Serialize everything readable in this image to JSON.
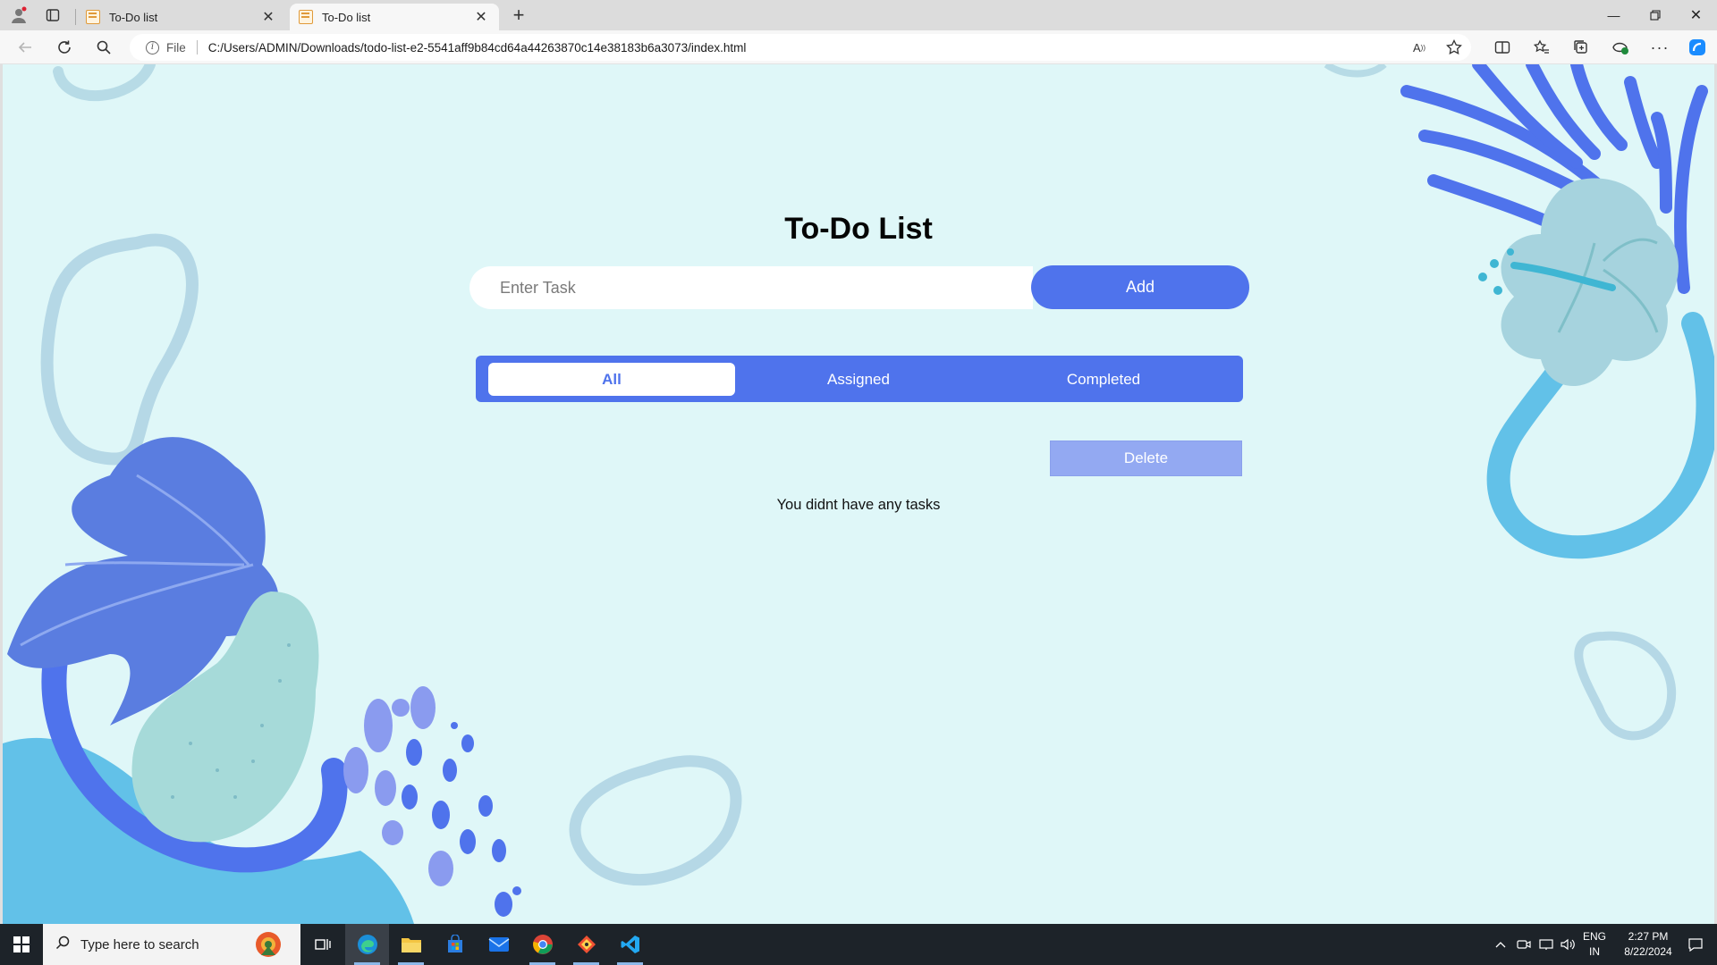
{
  "browser": {
    "tabs": [
      {
        "title": "To-Do list",
        "active": false
      },
      {
        "title": "To-Do list",
        "active": true
      }
    ],
    "address": {
      "scheme_label": "File",
      "url": "C:/Users/ADMIN/Downloads/todo-list-e2-5541aff9b84cd64a44263870c14e38183b6a3073/index.html"
    }
  },
  "app": {
    "title": "To-Do List",
    "input": {
      "placeholder": "Enter Task",
      "value": ""
    },
    "add_label": "Add",
    "filters": [
      {
        "label": "All",
        "active": true
      },
      {
        "label": "Assigned",
        "active": false
      },
      {
        "label": "Completed",
        "active": false
      }
    ],
    "delete_label": "Delete",
    "empty_message": "You didnt have any tasks"
  },
  "taskbar": {
    "search_placeholder": "Type here to search",
    "language": "ENG",
    "region": "IN",
    "time": "2:27 PM",
    "date": "8/22/2024"
  },
  "colors": {
    "page_background": "#dff7f8",
    "accent": "#4f73ec",
    "delete_button": "#93a9f2"
  }
}
